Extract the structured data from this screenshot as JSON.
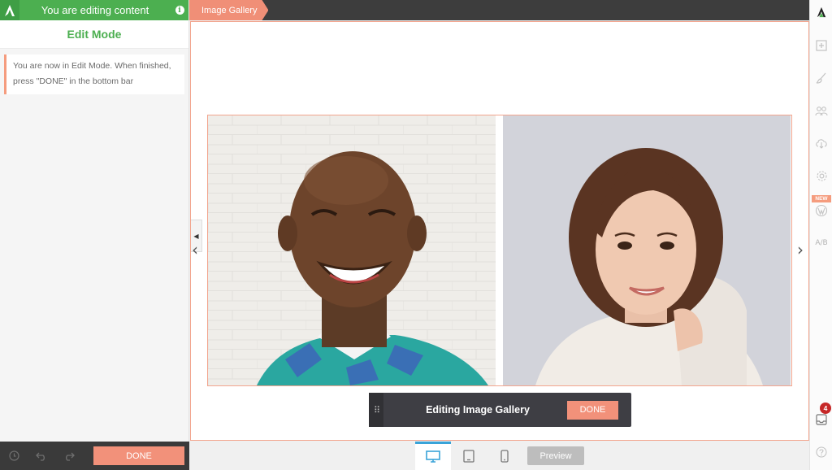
{
  "app": {
    "status_title": "You are editing content",
    "mode_title": "Edit Mode",
    "notice": "You are now in Edit Mode. When finished, press \"DONE\" in the bottom bar",
    "done_label": "DONE"
  },
  "breadcrumb": {
    "current": "Image Gallery"
  },
  "edit_bar": {
    "title": "Editing Image Gallery",
    "done_label": "DONE"
  },
  "device_bar": {
    "preview_label": "Preview",
    "active_device": "desktop"
  },
  "right_bar": {
    "new_label": "NEW",
    "ab_label": "A/B",
    "notification_count": "4"
  },
  "colors": {
    "green": "#4caf50",
    "accent": "#f2917a",
    "dark": "#3d3d3d",
    "active_blue": "#3aa3d8"
  },
  "icons": [
    "logo-a-icon",
    "info-icon",
    "history-icon",
    "undo-icon",
    "redo-icon",
    "chevron-left-icon",
    "chevron-right-icon",
    "desktop-icon",
    "tablet-icon",
    "mobile-icon",
    "plus-icon",
    "brush-icon",
    "people-icon",
    "cloud-download-icon",
    "gear-icon",
    "wordpress-icon",
    "inbox-icon",
    "help-icon"
  ]
}
